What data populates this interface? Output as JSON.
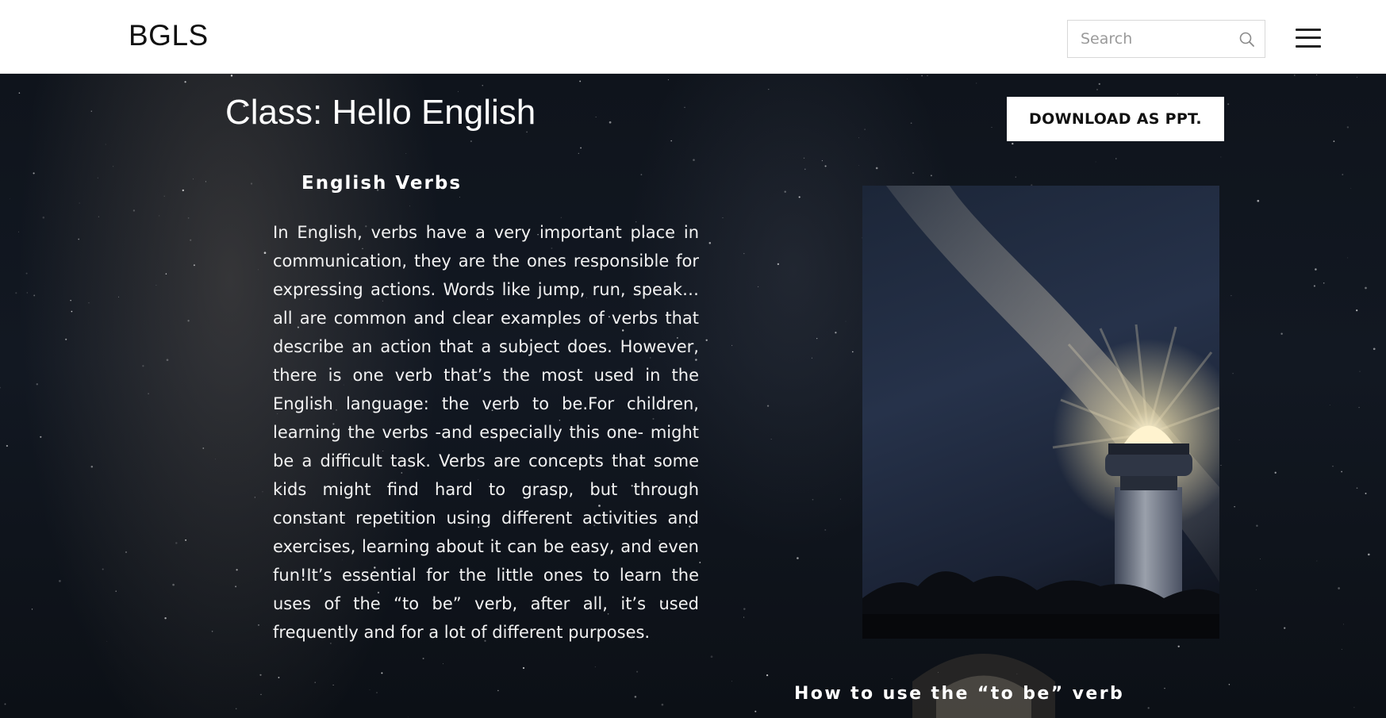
{
  "header": {
    "brand": "BGLS",
    "search_placeholder": "Search",
    "search_icon": "search-icon",
    "menu_icon": "hamburger-menu-icon"
  },
  "main": {
    "class_title": "Class: Hello English",
    "download_label": "DOWNLOAD AS PPT.",
    "section_heading": "English Verbs",
    "body": "In English, verbs have a very important place in communication, they are the ones responsible for expressing actions. Words like jump, run, speak… all are common and clear examples of verbs that describe an action that a subject does. However, there is one verb that’s the most used in the English language: the verb to be.For children, learning the verbs -and especially this one- might be a difficult task. Verbs are concepts that some kids might find hard to grasp, but through constant repetition using different activities and exercises, learning about it can be easy, and even fun!It’s essential for the little ones to learn the uses of the “to be” verb, after all, it’s used frequently and for a lot of different purposes.",
    "subheading": "How to use the “to be” verb"
  },
  "colors": {
    "header_bg": "#ffffff",
    "hero_bg": "#121822",
    "text": "#ffffff",
    "button_bg": "#ffffff",
    "button_text": "#111111"
  }
}
